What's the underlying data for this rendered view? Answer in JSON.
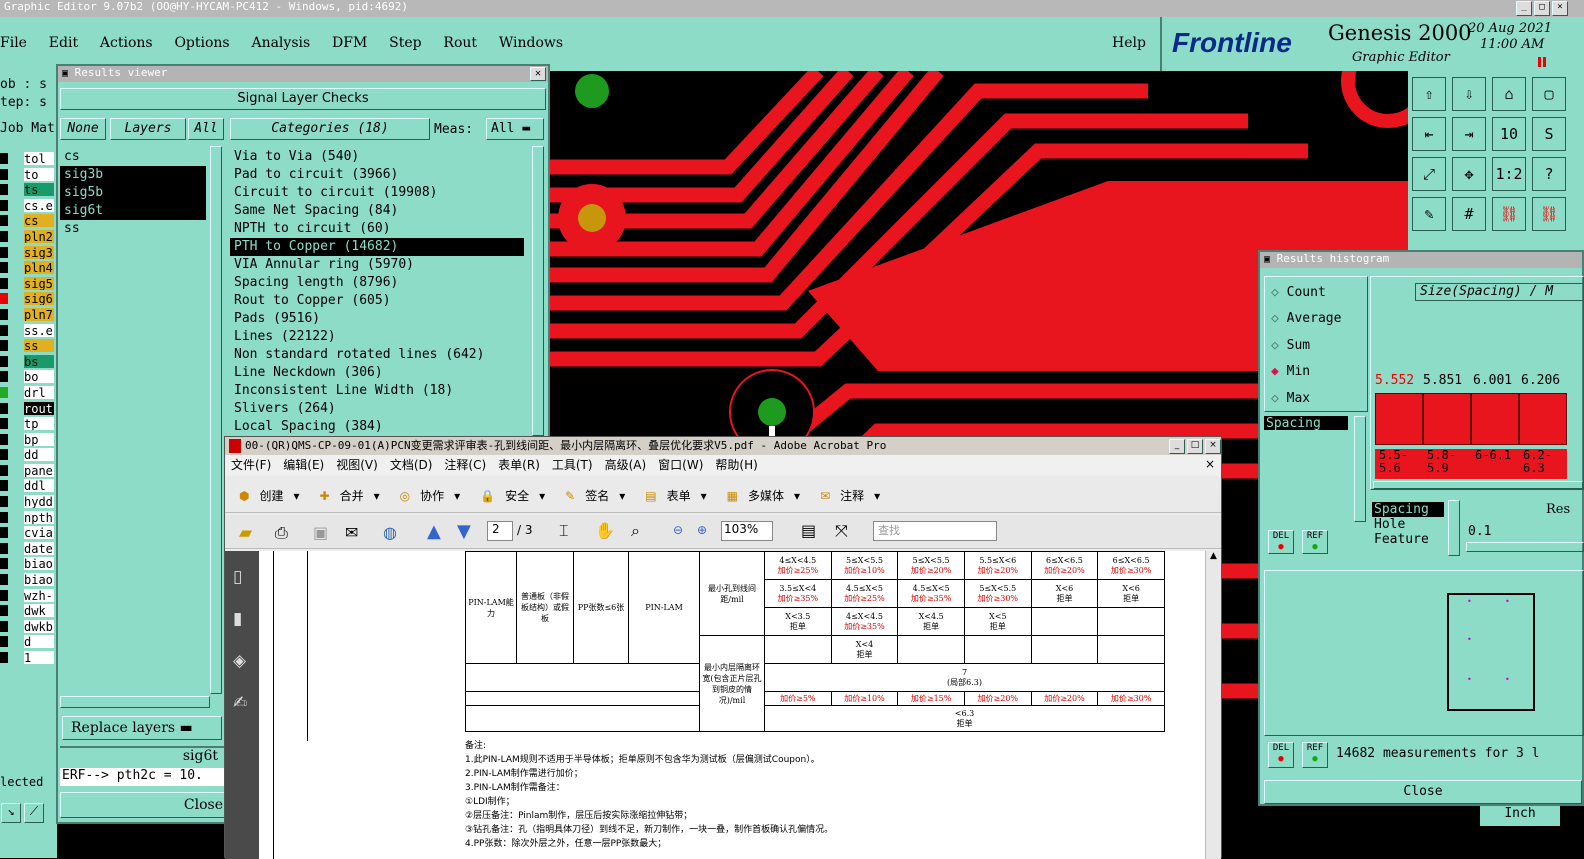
{
  "main_window": {
    "title": "Graphic Editor 9.07b2 (OO@HY-HYCAM-PC412 - Windows, pid:4692)",
    "menu": [
      "File",
      "Edit",
      "Actions",
      "Options",
      "Analysis",
      "DFM",
      "Step",
      "Rout",
      "Windows"
    ],
    "help": "Help",
    "brand": "Frontline",
    "product": "Genesis 2000",
    "subtitle": "Graphic Editor",
    "date": "20 Aug 2021",
    "time": "11:00 AM"
  },
  "left_panel": {
    "job_label": "ob : s",
    "step_label": "tep: s",
    "jobmat": "Job Mat",
    "layers": [
      "tol",
      "to",
      "ts",
      "cs.e",
      "cs",
      "pln2",
      "sig3",
      "pln4",
      "sig5",
      "sig6",
      "pln7",
      "ss.e",
      "ss",
      "bs",
      "bo",
      "drl",
      "rout",
      "tp",
      "bp",
      "dd",
      "pane",
      "ddl",
      "hydd",
      "npth",
      "cvia",
      "date",
      "biao",
      "biao",
      "wzh-",
      "dwk",
      "dwkb",
      "d",
      "1"
    ],
    "status": "lected"
  },
  "results_viewer": {
    "title": "Results viewer",
    "header": "Signal Layer Checks",
    "none_label": "None",
    "layers_label": "Layers",
    "all_label": "All",
    "categories_label": "Categories (18)",
    "meas_label": "Meas:",
    "meas_value": "All",
    "layers": [
      "cs",
      "sig3b",
      "sig5b",
      "sig6t",
      "ss"
    ],
    "categories": [
      "Via to Via (540)",
      "Pad to circuit (3966)",
      "Circuit to circuit (19908)",
      "Same Net Spacing (84)",
      "NPTH to circuit (60)",
      "PTH to Copper (14682)",
      "VIA Annular ring (5970)",
      "Spacing length (8796)",
      "Rout to Copper (605)",
      "Pads (9516)",
      "Lines (22122)",
      "Non standard rotated lines (642)",
      "Line Neckdown (306)",
      "Inconsistent Line Width (18)",
      "Slivers (264)",
      "Local Spacing (384)"
    ],
    "replace_label": "Replace layers",
    "current_layer": "sig6t",
    "erf_line": "ERF--> pth2c = 10.",
    "close_label": "Close"
  },
  "acrobat": {
    "title": "00-(QR)QMS-CP-09-01(A)PCN变更需求评审表-孔到线间距、最小内层隔离环、叠层优化要求V5.pdf - Adobe Acrobat Pro",
    "menu": [
      "文件(F)",
      "编辑(E)",
      "视图(V)",
      "文档(D)",
      "注释(C)",
      "表单(R)",
      "工具(T)",
      "高级(A)",
      "窗口(W)",
      "帮助(H)"
    ],
    "toolbar": [
      "创建",
      "合并",
      "协作",
      "安全",
      "签名",
      "表单",
      "多媒体",
      "注释"
    ],
    "page_current": "2",
    "page_total": "/ 3",
    "zoom": "103%",
    "search_placeholder": "查找",
    "doc": {
      "row_label": "PIN-LAM能力",
      "board_type": "普通板（非假板结构）或假板",
      "pp_count": "PP张数≤6张",
      "method": "PIN-LAM",
      "hole_to_line": "最小孔到线间距/mil",
      "inner_ring": "最小内层隔离环宽(包含正片层孔到铜皮的情况)/mil",
      "r1": [
        "4≤X<4.5",
        "5≤X<5.5",
        "5≤X<5.5",
        "5.5≤X<6",
        "6≤X<6.5",
        "6≤X<6.5"
      ],
      "r1p": [
        "加价≥25%",
        "加价≥10%",
        "加价≥20%",
        "加价≥20%",
        "加价≥20%",
        "加价≥30%"
      ],
      "r2": [
        "3.5≤X<4",
        "4.5≤X<5",
        "4.5≤X<5",
        "5≤X<5.5",
        "X<6",
        "X<6"
      ],
      "r2p": [
        "加价≥35%",
        "加价≥25%",
        "加价≥35%",
        "加价≥30%",
        "拒单",
        "拒单"
      ],
      "r3": [
        "X<3.5",
        "4≤X<4.5",
        "X<4.5",
        "X<5"
      ],
      "r3p": [
        "拒单",
        "加价≥35%",
        "拒单",
        "拒单"
      ],
      "r4": "X<4",
      "r4p": "拒单",
      "ring_val": "7",
      "ring_note": "(局部6.3)",
      "ring_prices": [
        "加价≥5%",
        "加价≥10%",
        "加价≥15%",
        "加价≥20%",
        "加价≥20%",
        "加价≥30%"
      ],
      "ring_low": "<6.3",
      "ring_low_p": "拒单",
      "notes": [
        "备注:",
        "1.此PIN-LAM规则不适用于半导体板；拒单原则不包含华为测试板（层偏测试Coupon）。",
        "2.PIN-LAM制作需进行加价；",
        "3.PIN-LAM制作需备注：",
        "①LDI制作；",
        "②层压备注：Pinlam制作，层压后按实际涨缩拉伸钻带；",
        "③钻孔备注：孔（指明具体刀径）到线不足，新刀制作，一块一叠，制作首板确认孔偏情况。",
        "4.PP张数：除次外层之外，任意一层PP张数最大；"
      ]
    }
  },
  "histogram": {
    "title": "Results histogram",
    "options": [
      "Count",
      "Average",
      "Sum",
      "Min",
      "Max"
    ],
    "selected_option": "Min",
    "size_label": "Size(Spacing) / M",
    "values": [
      "5.552",
      "5.851",
      "6.001",
      "6.206"
    ],
    "bins": [
      "5.5-5.6",
      "5.8-5.9",
      "6-6.1",
      "6.2-6.3"
    ],
    "spacing_tag": "Spacing",
    "list": [
      "Spacing",
      "Hole",
      "Feature"
    ],
    "res_label": "Res",
    "res_value": "0.1",
    "del_label": "DEL",
    "ref_label": "REF",
    "summary": "14682 measurements for 3 l",
    "close_label": "Close",
    "unit": "Inch"
  }
}
